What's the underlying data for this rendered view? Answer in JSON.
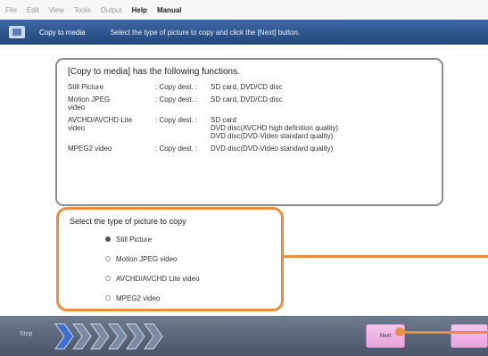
{
  "menubar": {
    "items": [
      "File",
      "Edit",
      "View",
      "Tools",
      "Output",
      "Help",
      "Manual"
    ]
  },
  "header": {
    "title": "Copy to media",
    "instruction": "Select the type of picture to copy and click the [Next] button."
  },
  "functions": {
    "title": "[Copy to media] has the following functions.",
    "rows": [
      {
        "type": "Still Picture",
        "dest_label": ": Copy dest. :",
        "dest": "SD card, DVD/CD disc"
      },
      {
        "type": "Motion JPEG\nvideo",
        "dest_label": ": Copy dest. :",
        "dest": "SD card, DVD/CD disc"
      },
      {
        "type": "AVCHD/AVCHD Lite\nvideo",
        "dest_label": ": Copy dest. :",
        "dest": "SD card\nDVD disc(AVCHD high definition quality)\nDVD disc(DVD-Video standard quality)"
      },
      {
        "type": "MPEG2 video",
        "dest_label": ": Copy dest. :",
        "dest": "DVD disc(DVD-Video standard quality)"
      }
    ]
  },
  "selection": {
    "title": "Select the type of picture to copy",
    "options": [
      {
        "label": "Still Picture",
        "selected": true
      },
      {
        "label": "Motion JPEG video",
        "selected": false
      },
      {
        "label": "AVCHD/AVCHD Lite video",
        "selected": false
      },
      {
        "label": "MPEG2 video",
        "selected": false
      }
    ]
  },
  "footer": {
    "step_label": "Step",
    "next_label": "Next",
    "cancel_label": ""
  },
  "colors": {
    "header": "#2f5a94",
    "callout": "#ea8e3d",
    "footer": "#59637a",
    "chevron": "#3b6fd6"
  }
}
